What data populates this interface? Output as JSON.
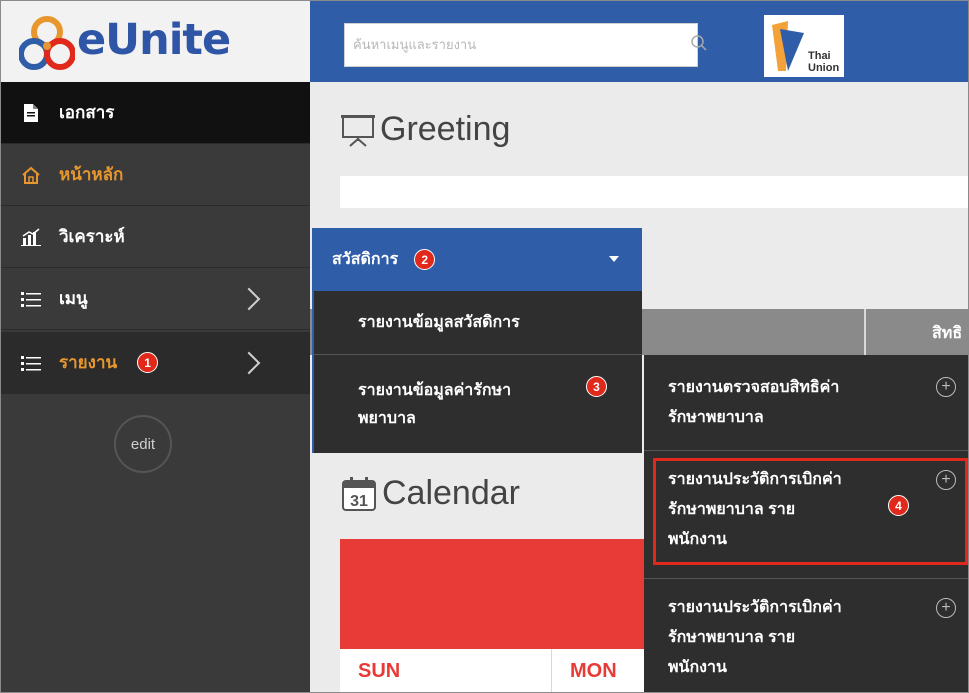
{
  "app": {
    "name": "eUnite",
    "brand_logo_text": "Thai Union"
  },
  "search": {
    "placeholder": "ค้นหาเมนูและรายงาน"
  },
  "sidebar": {
    "items": [
      {
        "label": "เอกสาร",
        "icon": "document-icon"
      },
      {
        "label": "หน้าหลัก",
        "icon": "home-icon"
      },
      {
        "label": "วิเคราะห์",
        "icon": "analytics-chart-icon"
      },
      {
        "label": "เมนู",
        "icon": "list-icon"
      },
      {
        "label": "รายงาน",
        "icon": "list-icon",
        "badge": "1"
      }
    ],
    "edit_label": "edit"
  },
  "main": {
    "greeting_title": "Greeting",
    "calendar_title": "Calendar",
    "calendar_icon_day": "31",
    "table_header_partial": "สิทธิ",
    "days": [
      "SUN",
      "MON"
    ]
  },
  "dropdown": {
    "header_label": "สวัสดิการ",
    "header_badge": "2",
    "items": [
      {
        "label": "รายงานข้อมูลสวัสดิการ"
      },
      {
        "label_line1": "รายงานข้อมูลค่ารักษา",
        "label_line2": "พยาบาล",
        "badge": "3"
      }
    ]
  },
  "submenu": {
    "items": [
      {
        "line1": "รายงานตรวจสอบสิทธิค่า",
        "line2": "รักษาพยาบาล",
        "line3": ""
      },
      {
        "line1": "รายงานประวัติการเบิกค่า",
        "line2": "รักษาพยาบาล ราย",
        "line3": "พนักงาน",
        "badge": "4",
        "highlighted": true
      },
      {
        "line1": "รายงานประวัติการเบิกค่า",
        "line2": "รักษาพยาบาล ราย",
        "line3": "พนักงาน"
      }
    ],
    "plus_symbol": "+"
  },
  "colors": {
    "header_blue": "#2f5da8",
    "sidebar_dark": "#3a3a3a",
    "active_orange": "#e8972e",
    "badge_red": "#e0281b",
    "calendar_red": "#e83a36"
  }
}
